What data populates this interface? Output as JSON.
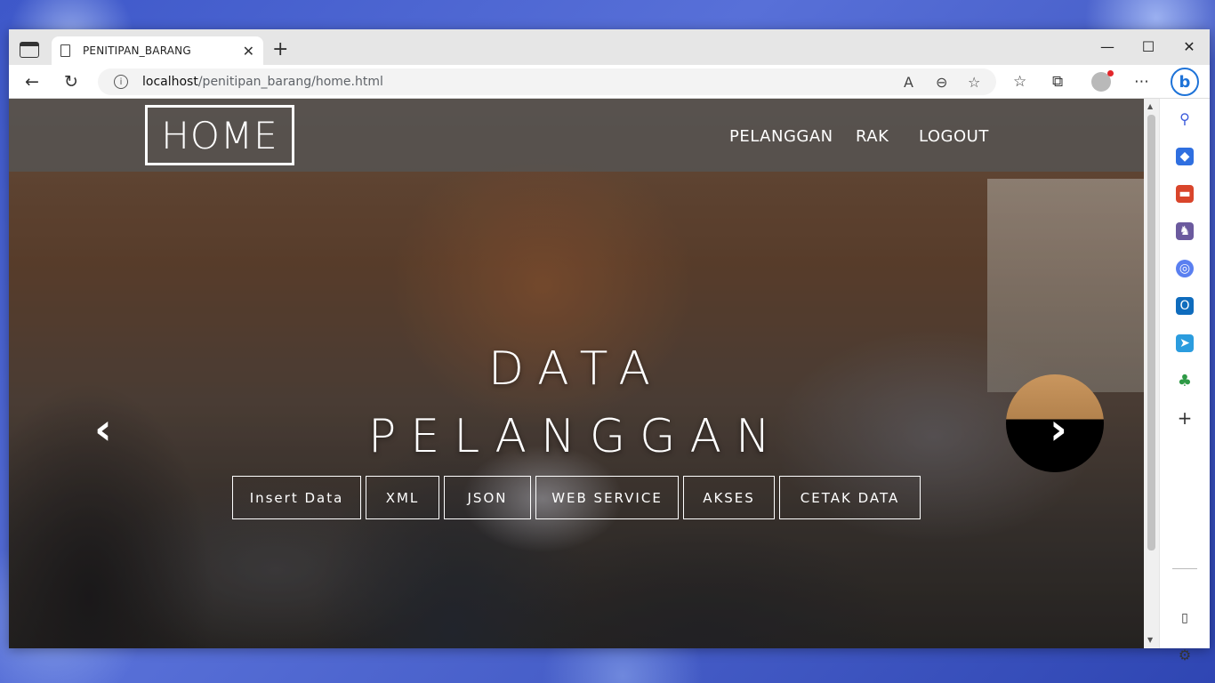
{
  "browser": {
    "tab_title": "PENITIPAN_BARANG",
    "new_tab": "+",
    "close_tab": "✕",
    "url_host": "localhost",
    "url_path": "/penitipan_barang/home.html",
    "window_controls": {
      "minimize": "—",
      "maximize": "☐",
      "close": "✕"
    },
    "bing_label": "b"
  },
  "sidebar": {
    "icons": [
      "search-icon",
      "shopping-tag-icon",
      "toolbox-icon",
      "games-icon",
      "microsoft365-icon",
      "outlook-icon",
      "send-icon",
      "tree-icon",
      "add-icon",
      "split-screen-icon",
      "settings-icon"
    ]
  },
  "page": {
    "brand": "HOME",
    "menu": [
      "PELANGGAN",
      "RAK",
      "LOGOUT"
    ],
    "hero_line1": "DATA",
    "hero_line2": "PELANGGAN",
    "buttons": [
      "Insert Data",
      "XML",
      "JSON",
      "WEB SERVICE",
      "AKSES",
      "CETAK DATA"
    ],
    "prev_arrow": "‹",
    "next_arrow": "›"
  }
}
